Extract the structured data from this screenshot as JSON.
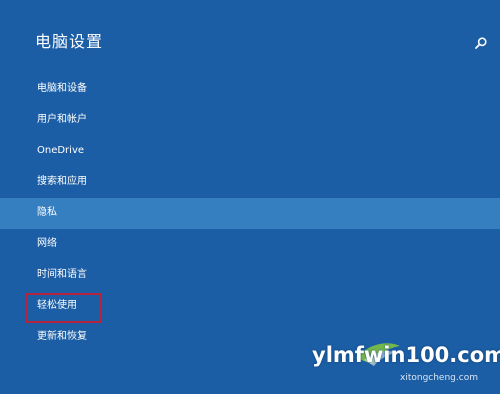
{
  "header": {
    "title": "电脑设置",
    "search_icon": "search-icon"
  },
  "nav": {
    "items": [
      {
        "label": "电脑和设备",
        "selected": false
      },
      {
        "label": "用户和帐户",
        "selected": false
      },
      {
        "label": "OneDrive",
        "selected": false
      },
      {
        "label": "搜索和应用",
        "selected": false
      },
      {
        "label": "隐私",
        "selected": true
      },
      {
        "label": "网络",
        "selected": false
      },
      {
        "label": "时间和语言",
        "selected": false
      },
      {
        "label": "轻松使用",
        "selected": false
      },
      {
        "label": "更新和恢复",
        "selected": false
      }
    ]
  },
  "annotation": {
    "highlighted_item": "轻松使用",
    "box_color": "#b5233e"
  },
  "watermark": {
    "main": "ylmfwin100.com",
    "sub": "xitongcheng.com"
  },
  "colors": {
    "background": "#1b5ea5",
    "selected": "#357ebf",
    "text": "#ffffff"
  }
}
